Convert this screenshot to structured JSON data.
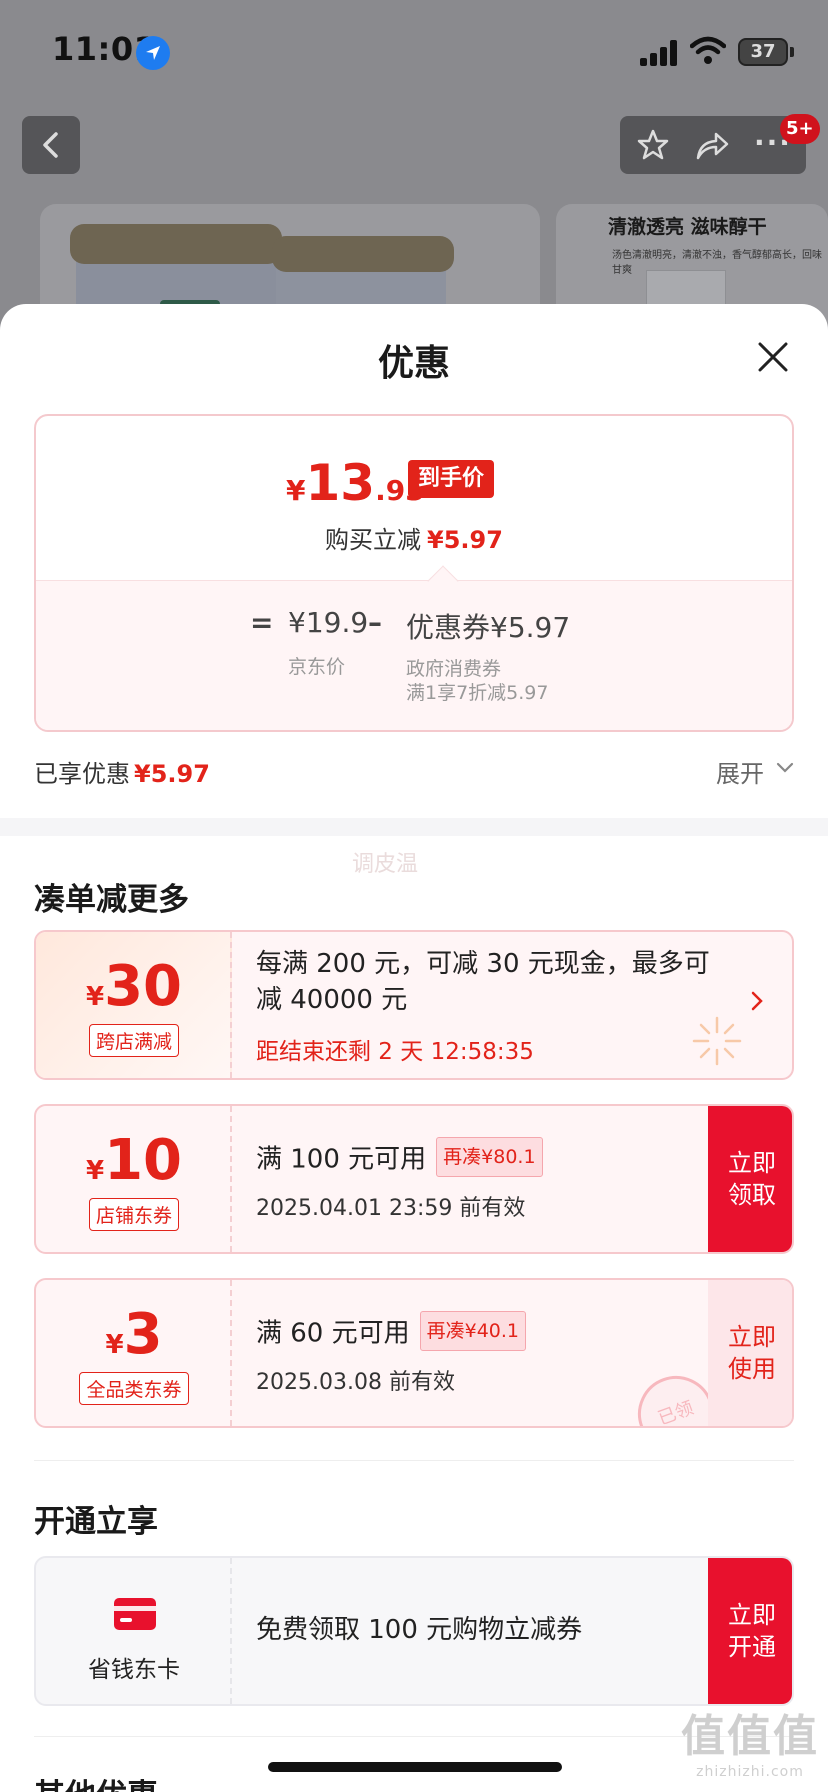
{
  "status_bar": {
    "time": "11:01",
    "battery": "37"
  },
  "nav": {
    "badge": "5+",
    "more": "···"
  },
  "background": {
    "side_title": "清澈透亮 滋味醇干",
    "side_subtitle": "汤色清澈明亮，清澈不浊，香气醇郁高长，回味甘爽"
  },
  "sheet": {
    "title": "优惠",
    "price": {
      "yen": "¥",
      "integer": "13",
      "decimal": ".93",
      "tag": "到手价",
      "reduce_label": "购买立减",
      "reduce_amount": "¥5.97",
      "formula_eq": "=",
      "jd_price": "¥19.9",
      "formula_minus": "–",
      "coupon_part": "优惠券¥5.97",
      "jd_price_label": "京东价",
      "coupon_label_1": "政府消费券",
      "coupon_label_2": "满1享7折减5.97"
    },
    "enjoyed_label": "已享优惠",
    "enjoyed_amount": "¥5.97",
    "expand_label": "展开",
    "watermark": "调皮温",
    "section_more": "凑单减更多",
    "coupons": [
      {
        "yen": "¥",
        "amount": "30",
        "tag": "跨店满减",
        "desc_line1": "每满 200 元，可减 30 元现金，最多可",
        "desc_line2": "减 40000 元",
        "countdown": "距结束还剩 2 天 12:58:35"
      },
      {
        "yen": "¥",
        "amount": "10",
        "tag": "店铺东券",
        "condition": "满 100 元可用",
        "more": "再凑¥80.1",
        "valid": "2025.04.01 23:59 前有效",
        "button_line1": "立即",
        "button_line2": "领取"
      },
      {
        "yen": "¥",
        "amount": "3",
        "tag": "全品类东券",
        "condition": "满 60 元可用",
        "more": "再凑¥40.1",
        "valid": "2025.03.08 前有效",
        "button_line1": "立即",
        "button_line2": "使用",
        "stamp": "已领"
      }
    ],
    "section_member": "开通立享",
    "member": {
      "label": "省钱东卡",
      "desc": "免费领取 100 元购物立减券",
      "button_line1": "立即",
      "button_line2": "开通"
    },
    "section_other": "其他优惠"
  },
  "site_watermark": {
    "big": "值值值",
    "small": "zhizhizhi.com"
  },
  "colors": {
    "accent": "#e2231a",
    "button": "#e8112d",
    "border": "#f6c8cc"
  }
}
